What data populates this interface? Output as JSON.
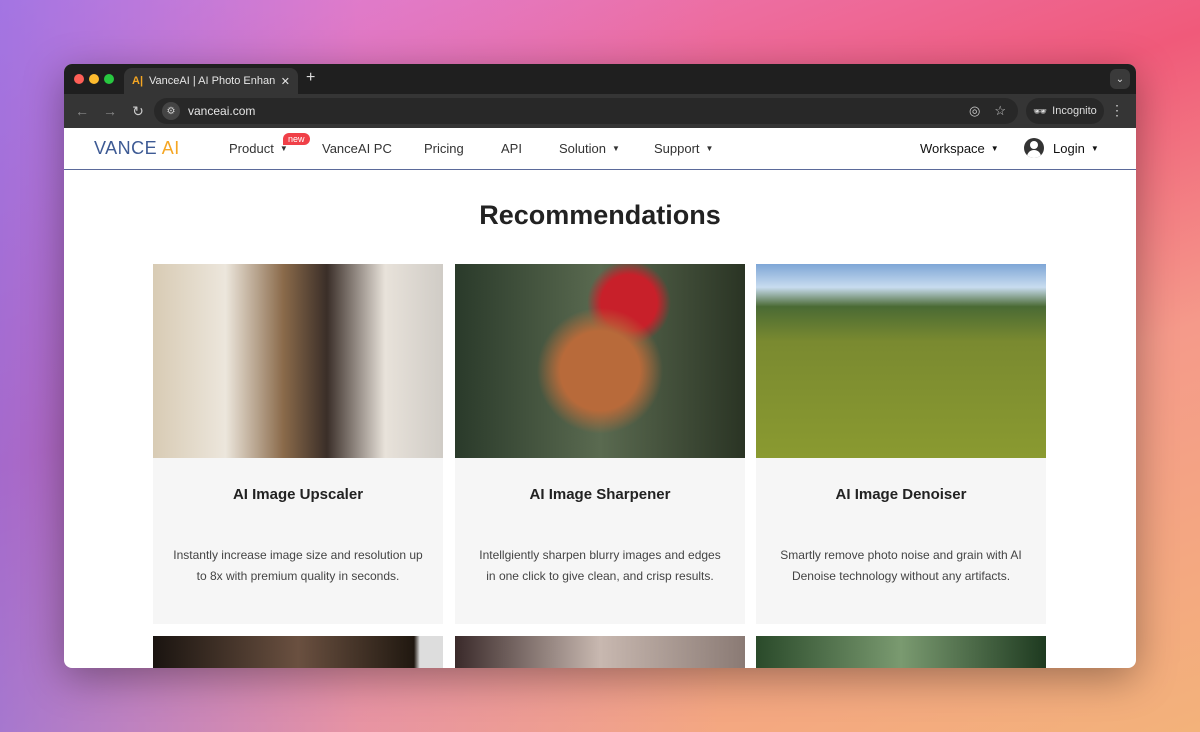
{
  "browser": {
    "tab_title": "VanceAI | AI Photo Enhancem",
    "url": "vanceai.com",
    "incognito_label": "Incognito"
  },
  "nav": {
    "logo_main": "VANCE",
    "logo_accent": "AI",
    "items": [
      "Product",
      "VanceAI PC",
      "Pricing",
      "API",
      "Solution",
      "Support"
    ],
    "new_badge": "new",
    "workspace": "Workspace",
    "login": "Login"
  },
  "page": {
    "title": "Recommendations"
  },
  "cards": [
    {
      "title": "AI Image Upscaler",
      "desc": "Instantly increase image size and resolution up to 8x with premium quality in seconds."
    },
    {
      "title": "AI Image Sharpener",
      "desc": "Intellgiently sharpen blurry images and edges in one click to give clean, and crisp results."
    },
    {
      "title": "AI Image Denoiser",
      "desc": "Smartly remove photo noise and grain with AI Denoise technology without any artifacts."
    }
  ],
  "colors": {
    "brand": "#3d5a94",
    "accent": "#f5a623",
    "badge": "#f04048"
  }
}
